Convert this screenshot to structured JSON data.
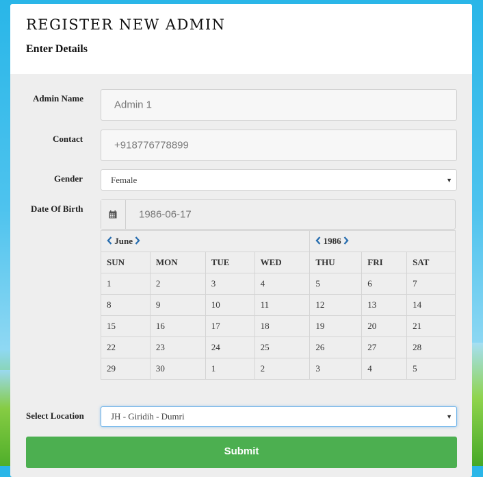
{
  "page": {
    "title": "REGISTER NEW ADMIN",
    "subtitle": "Enter Details"
  },
  "form": {
    "admin_name": {
      "label": "Admin Name",
      "placeholder": "Admin 1"
    },
    "contact": {
      "label": "Contact",
      "placeholder": "+918776778899"
    },
    "gender": {
      "label": "Gender",
      "value": "Female"
    },
    "dob": {
      "label": "Date Of Birth",
      "value": "1986-06-17"
    },
    "location": {
      "label": "Select Location",
      "value": "JH - Giridih - Dumri"
    },
    "submit_label": "Submit"
  },
  "calendar": {
    "month": "June",
    "year": "1986",
    "weekdays": [
      "SUN",
      "MON",
      "TUE",
      "WED",
      "THU",
      "FRI",
      "SAT"
    ],
    "weeks": [
      [
        "1",
        "2",
        "3",
        "4",
        "5",
        "6",
        "7"
      ],
      [
        "8",
        "9",
        "10",
        "11",
        "12",
        "13",
        "14"
      ],
      [
        "15",
        "16",
        "17",
        "18",
        "19",
        "20",
        "21"
      ],
      [
        "22",
        "23",
        "24",
        "25",
        "26",
        "27",
        "28"
      ],
      [
        "29",
        "30",
        "1",
        "2",
        "3",
        "4",
        "5"
      ]
    ]
  },
  "icons": {
    "calendar": "calendar-icon",
    "prev": "chevron-left-icon",
    "next": "chevron-right-icon",
    "caret": "caret-down-icon"
  },
  "colors": {
    "submit": "#4caf50",
    "nav_arrow": "#2a6fb0",
    "focus_border": "#66afe9"
  }
}
